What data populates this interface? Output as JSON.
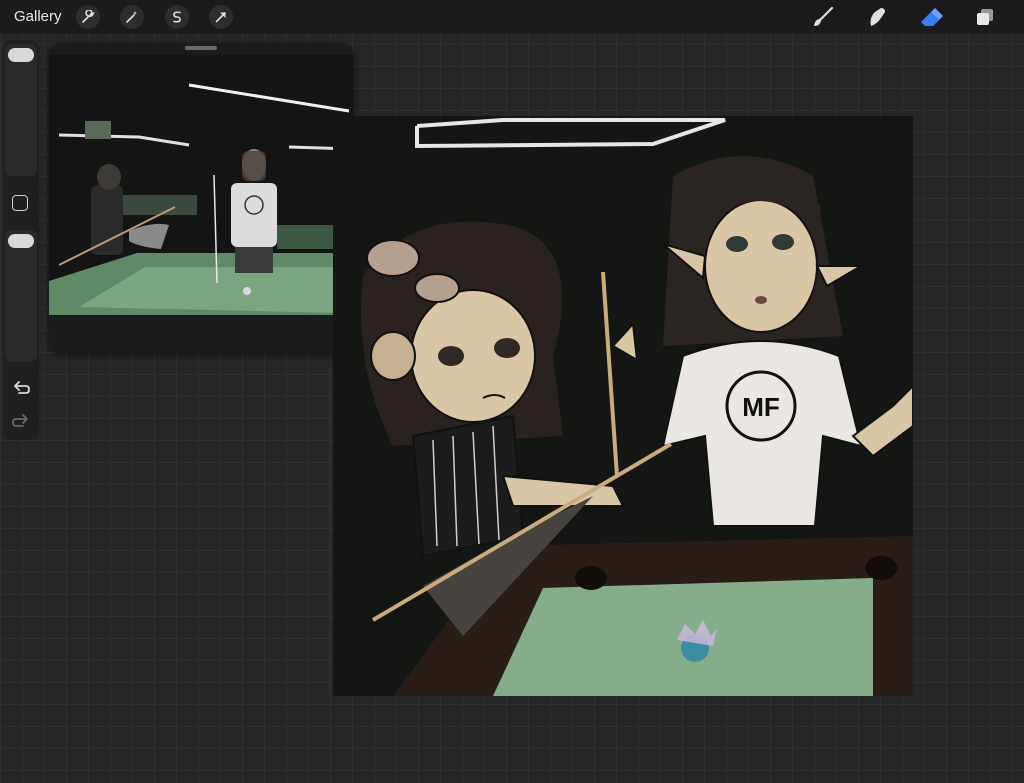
{
  "toolbar": {
    "gallery_label": "Gallery",
    "left_tools": [
      "wrench-icon",
      "magic-wand-icon",
      "selection-s-icon",
      "transform-arrow-icon"
    ],
    "right_tools": [
      "brush-icon",
      "smudge-icon",
      "eraser-icon",
      "layers-icon"
    ],
    "active_tool": "eraser",
    "accent_color": "#3a7ff6"
  },
  "sidebar": {
    "controls": [
      "brush-size-slider",
      "modify-button",
      "opacity-slider",
      "undo-icon",
      "redo-icon"
    ]
  },
  "reference": {
    "panel": "reference-window",
    "photo": "pool-hall-photo"
  },
  "canvas": {
    "artwork": "drawing-two-characters-pool-table",
    "tshirt_logo": "MF"
  }
}
